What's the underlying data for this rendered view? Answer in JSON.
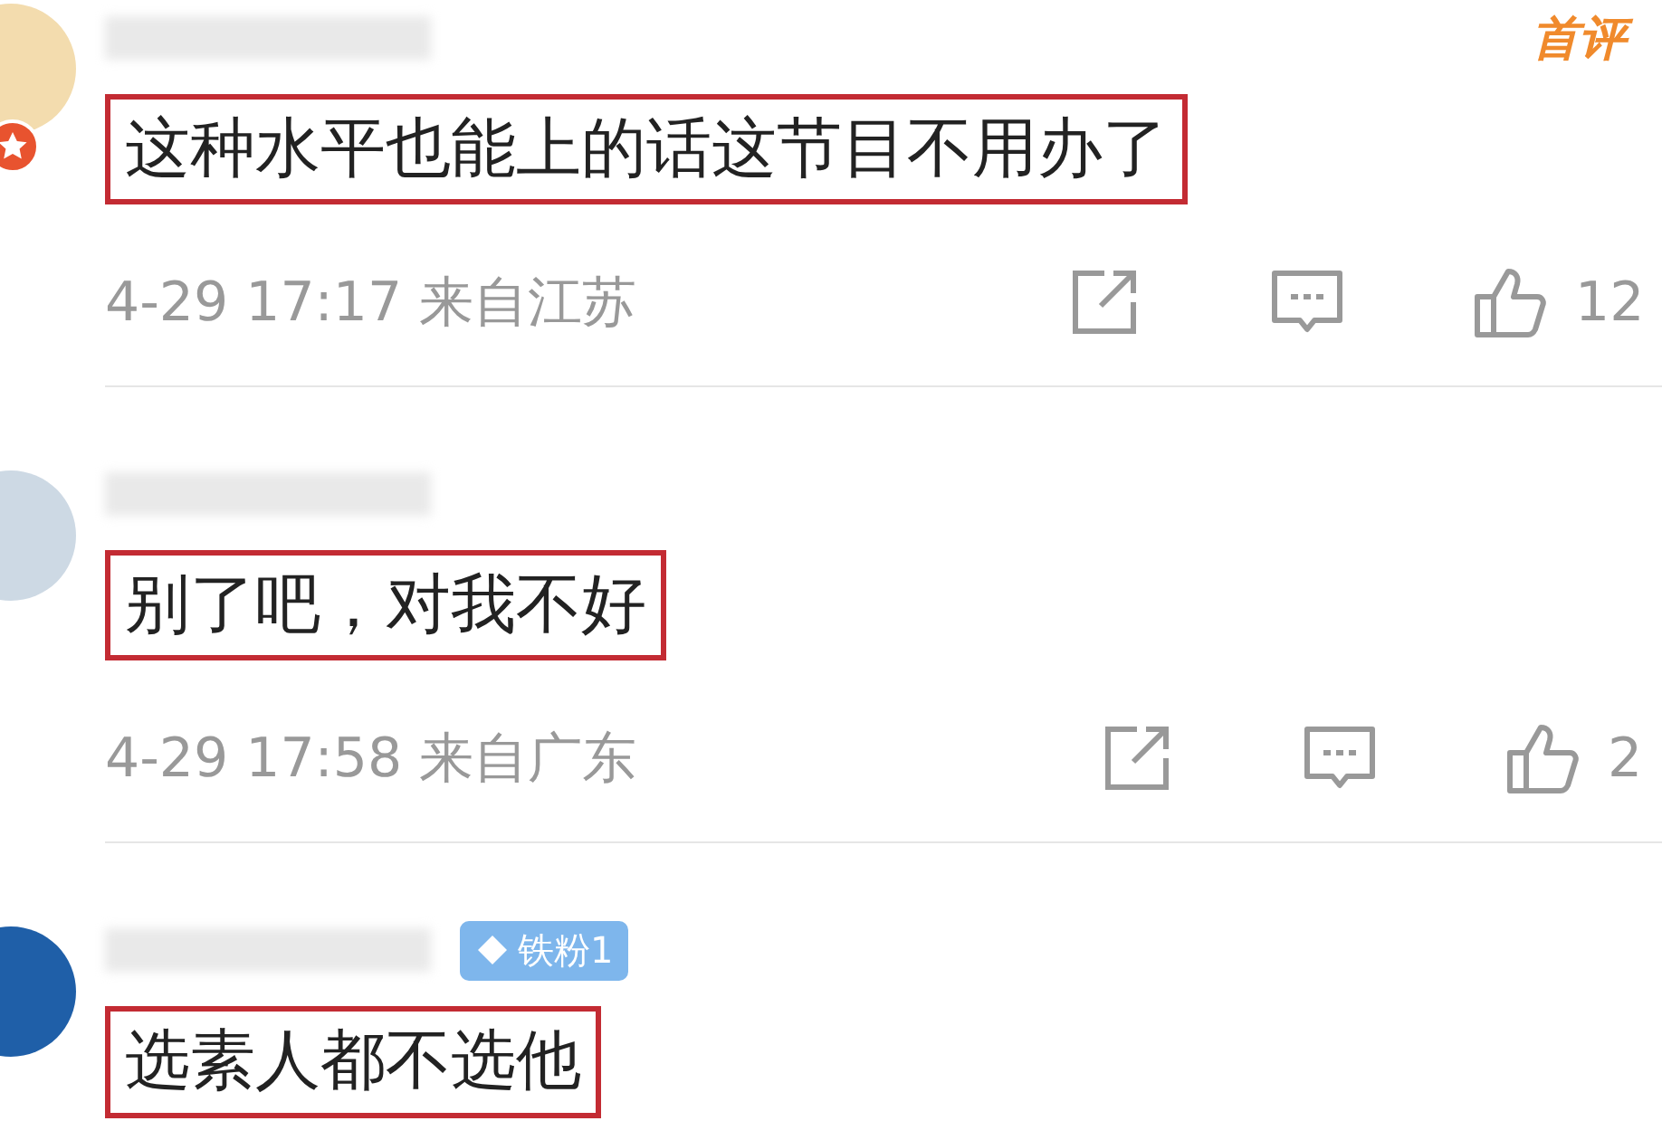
{
  "comments": [
    {
      "avatar_badge": true,
      "tag": "首评",
      "text": "这种水平也能上的话这节目不用办了",
      "time": "4-29 17:17",
      "location": "来自江苏",
      "likes": "12"
    },
    {
      "avatar_badge": false,
      "text": "别了吧，对我不好",
      "time": "4-29 17:58",
      "location": "来自广东",
      "likes": "2"
    },
    {
      "avatar_badge": false,
      "fan_badge": "铁粉1",
      "text": "选素人都不选他"
    }
  ]
}
